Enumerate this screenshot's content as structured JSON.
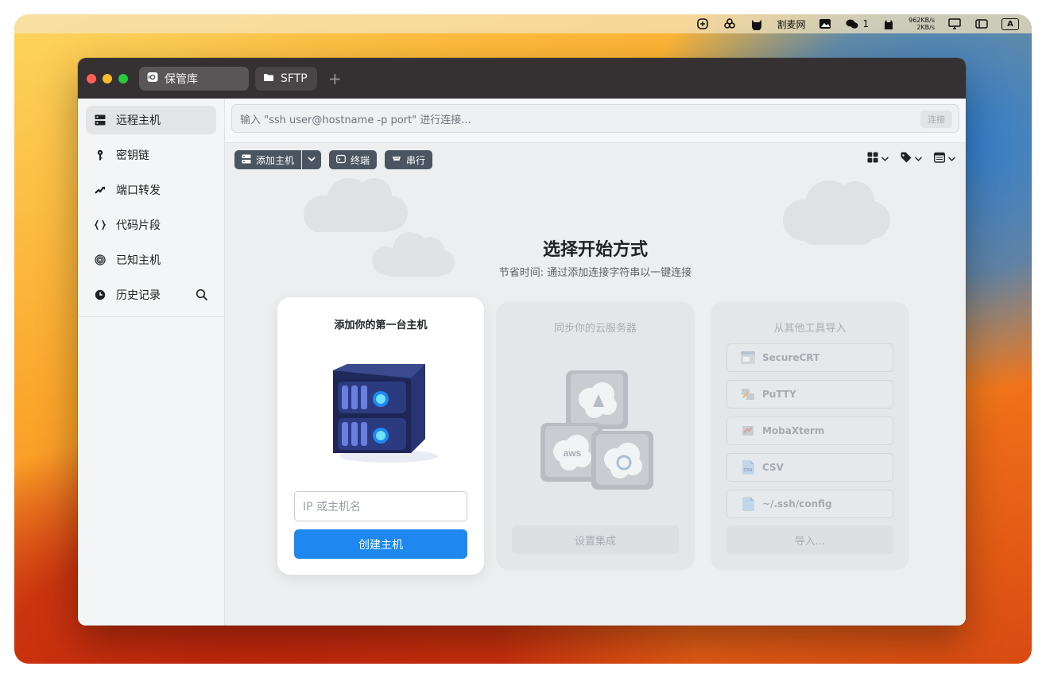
{
  "menubar": {
    "items": [
      "copilot-icon",
      "connections-icon",
      "cat-icon",
      "割麦网",
      "image-icon",
      "wechat-icon",
      "1",
      "cat-silhouette-icon",
      "962KB/s",
      "2KB/s",
      "display-icon",
      "control-center-icon",
      "A"
    ],
    "app_text": "割麦网",
    "wechat_count": "1",
    "net_up": "962KB/s",
    "net_down": "2KB/s",
    "input_method": "A"
  },
  "window": {
    "tabs": [
      {
        "label": "保管库",
        "icon": "vault-icon"
      },
      {
        "label": "SFTP",
        "icon": "folder-icon"
      }
    ],
    "add_tab": "+"
  },
  "sidebar": {
    "items": [
      {
        "label": "远程主机",
        "icon": "server-icon",
        "active": true
      },
      {
        "label": "密钥链",
        "icon": "key-icon"
      },
      {
        "label": "端口转发",
        "icon": "port-forward-icon"
      },
      {
        "label": "代码片段",
        "icon": "braces-icon"
      },
      {
        "label": "已知主机",
        "icon": "fingerprint-icon"
      },
      {
        "label": "历史记录",
        "icon": "history-icon"
      }
    ]
  },
  "command": {
    "placeholder": "输入 \"ssh user@hostname -p port\" 进行连接...",
    "connect_label": "连接"
  },
  "toolbar": {
    "add_host": "添加主机",
    "terminal": "终端",
    "serial": "串行"
  },
  "main": {
    "heading": "选择开始方式",
    "subheading": "节省时间: 通过添加连接字符串以一键连接"
  },
  "card_add": {
    "title": "添加你的第一台主机",
    "input_placeholder": "IP 或主机名",
    "create_label": "创建主机"
  },
  "card_cloud": {
    "title": "同步你的云服务器",
    "providers": [
      "azure",
      "aws",
      "digitalocean"
    ],
    "aws_text": "aws",
    "setup_label": "设置集成"
  },
  "card_import": {
    "title": "从其他工具导入",
    "items": [
      "SecureCRT",
      "PuTTY",
      "MobaXterm",
      "CSV",
      "~/.ssh/config"
    ],
    "import_label": "导入..."
  },
  "colors": {
    "accent": "#1e88f0",
    "titlebar": "#353133",
    "toolbar_button": "#4b5562",
    "close": "#fe5f57",
    "minimize": "#febc2e",
    "zoom": "#28c840"
  }
}
